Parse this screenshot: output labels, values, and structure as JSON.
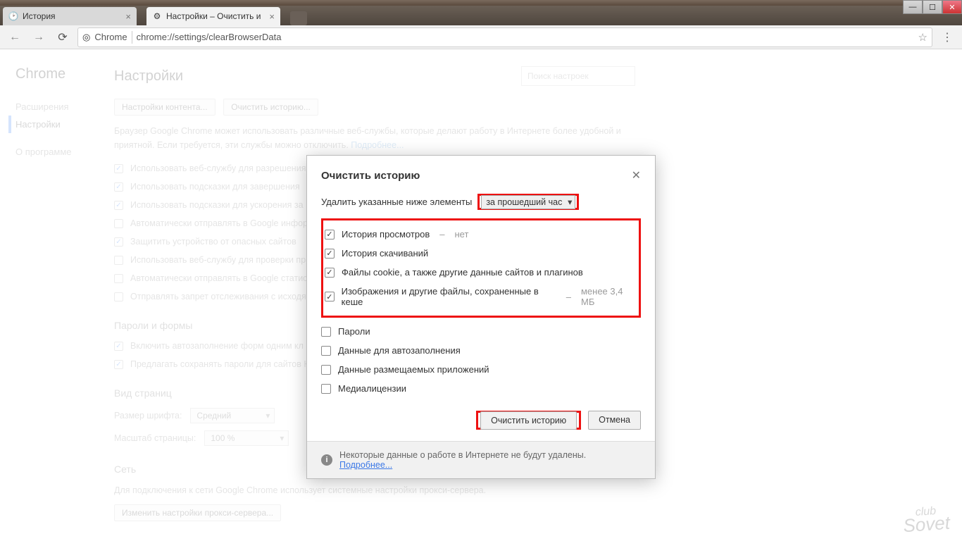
{
  "window": {
    "tabs": [
      {
        "title": "История",
        "active": false
      },
      {
        "title": "Настройки – Очистить и",
        "active": true
      }
    ]
  },
  "toolbar": {
    "url_label": "Chrome",
    "url_path": "chrome://settings/clearBrowserData"
  },
  "sidebar": {
    "product": "Chrome",
    "items": [
      {
        "label": "Расширения"
      },
      {
        "label": "Настройки"
      },
      {
        "label": "О программе"
      }
    ]
  },
  "page": {
    "title": "Настройки",
    "search_placeholder": "Поиск настроек",
    "content_settings_btn": "Настройки контента...",
    "clear_history_btn": "Очистить историю...",
    "services_para": "Браузер Google Chrome может использовать различные веб-службы, которые делают работу в Интернете более удобной и приятной. Если требуется, эти службы можно отключить. ",
    "services_more": "Подробнее...",
    "privacy_opts": [
      {
        "checked": true,
        "label": "Использовать веб-службу для разрешения"
      },
      {
        "checked": true,
        "label": "Использовать подсказки для завершения"
      },
      {
        "checked": true,
        "label": "Использовать подсказки для ускорения за"
      },
      {
        "checked": false,
        "label": "Автоматически отправлять в Google инфор"
      },
      {
        "checked": true,
        "label": "Защитить устройство от опасных сайтов"
      },
      {
        "checked": false,
        "label": "Использовать веб-службу для проверки пр"
      },
      {
        "checked": false,
        "label": "Автоматически отправлять в Google статис"
      },
      {
        "checked": false,
        "label": "Отправлять запрет отслеживания с исходя"
      }
    ],
    "passwords_h": "Пароли и формы",
    "passwords_opts": [
      {
        "checked": true,
        "label": "Включить автозаполнение форм одним кл"
      },
      {
        "checked": true,
        "label": "Предлагать сохранять пароли для сайтов Н"
      }
    ],
    "view_h": "Вид страниц",
    "font_label": "Размер шрифта:",
    "font_value": "Средний",
    "zoom_label": "Масштаб страницы:",
    "zoom_value": "100 %",
    "net_h": "Сеть",
    "net_para": "Для подключения к сети Google Chrome использует системные настройки прокси-сервера.",
    "net_btn": "Изменить настройки прокси-сервера..."
  },
  "modal": {
    "title": "Очистить историю",
    "delete_label": "Удалить указанные ниже элементы",
    "time_range": "за прошедший час",
    "items": [
      {
        "checked": true,
        "label": "История просмотров",
        "suffix": "нет"
      },
      {
        "checked": true,
        "label": "История скачиваний",
        "suffix": ""
      },
      {
        "checked": true,
        "label": "Файлы cookie, а также другие данные сайтов и плагинов",
        "suffix": ""
      },
      {
        "checked": true,
        "label": "Изображения и другие файлы, сохраненные в кеше",
        "suffix": "менее 3,4 МБ"
      },
      {
        "checked": false,
        "label": "Пароли",
        "suffix": ""
      },
      {
        "checked": false,
        "label": "Данные для автозаполнения",
        "suffix": ""
      },
      {
        "checked": false,
        "label": "Данные размещаемых приложений",
        "suffix": ""
      },
      {
        "checked": false,
        "label": "Медиалицензии",
        "suffix": ""
      }
    ],
    "clear_btn": "Очистить историю",
    "cancel_btn": "Отмена",
    "footer_text": "Некоторые данные о работе в Интернете не будут удалены. ",
    "footer_link": "Подробнее..."
  },
  "watermark": {
    "top": "club",
    "bottom": "Sovet"
  }
}
